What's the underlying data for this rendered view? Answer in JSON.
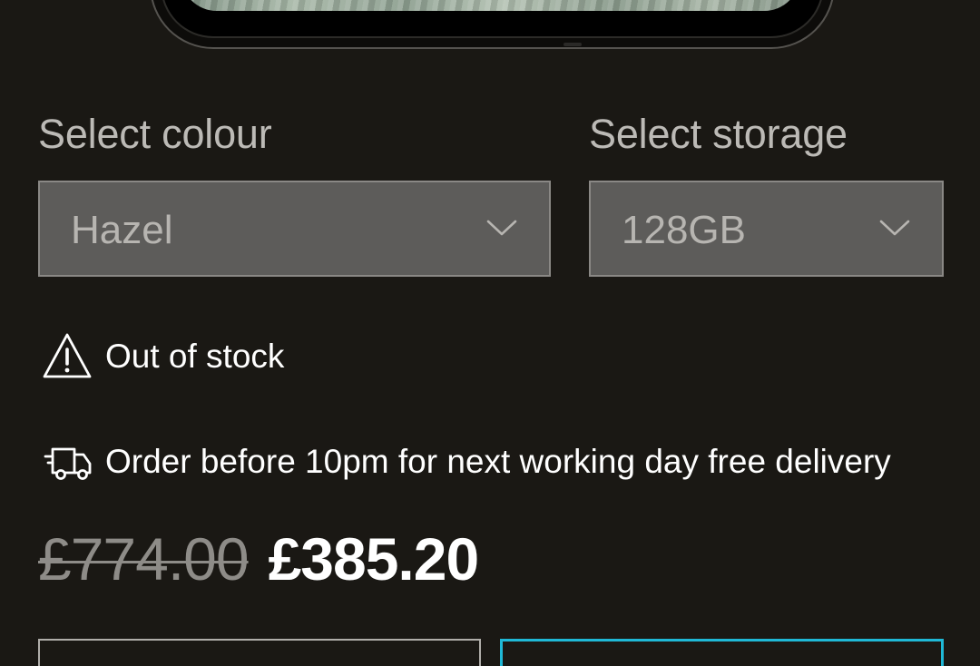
{
  "product_image": {
    "icon": "phone-image"
  },
  "colour": {
    "label": "Select colour",
    "value": "Hazel"
  },
  "storage": {
    "label": "Select storage",
    "value": "128GB"
  },
  "stock": {
    "icon": "warning-triangle-icon",
    "text": "Out of stock"
  },
  "delivery": {
    "icon": "delivery-truck-icon",
    "text": "Order before 10pm for next working day free delivery"
  },
  "price": {
    "original": "£774.00",
    "current": "£385.20"
  },
  "colors": {
    "background": "#1a1814",
    "select_bg": "#5d5c5a",
    "accent": "#1fb8d6"
  }
}
